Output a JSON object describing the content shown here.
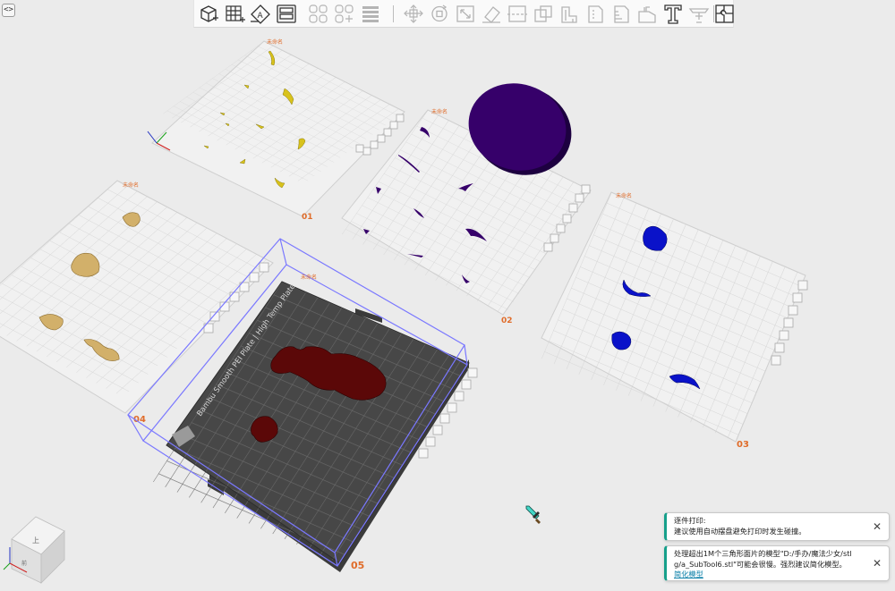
{
  "toolbar": {
    "collapse_label": "<>",
    "buttons": [
      {
        "icon": "add-object-icon",
        "label": ""
      },
      {
        "icon": "add-plate-icon",
        "label": ""
      },
      {
        "icon": "auto-orient-icon",
        "label": ""
      },
      {
        "icon": "arrange-icon",
        "label": ""
      },
      {
        "icon": "grid-layout-icon",
        "label": ""
      },
      {
        "icon": "grid-split-icon",
        "label": ""
      },
      {
        "icon": "list-layers-icon",
        "label": ""
      },
      {
        "icon": "move-icon",
        "label": ""
      },
      {
        "icon": "rotate-icon",
        "label": ""
      },
      {
        "icon": "scale-icon",
        "label": ""
      },
      {
        "icon": "lay-on-face-icon",
        "label": ""
      },
      {
        "icon": "cut-icon",
        "label": ""
      },
      {
        "icon": "boolean-icon",
        "label": ""
      },
      {
        "icon": "paint-support-icon",
        "label": ""
      },
      {
        "icon": "paint-seam-icon",
        "label": ""
      },
      {
        "icon": "measure-icon",
        "label": ""
      },
      {
        "icon": "color-paint-icon",
        "label": ""
      },
      {
        "icon": "text-emboss-icon",
        "label": "T"
      },
      {
        "icon": "assembly-icon",
        "label": ""
      },
      {
        "icon": "split-parts-icon",
        "label": ""
      }
    ]
  },
  "plates": [
    {
      "number": "01",
      "name": "未命名"
    },
    {
      "number": "02",
      "name": "未命名"
    },
    {
      "number": "03",
      "name": "未命名"
    },
    {
      "number": "04",
      "name": "未命名"
    },
    {
      "number": "05",
      "name": "未命名"
    }
  ],
  "plate_texture_text": "Bambu Smooth PEI Plate | High Temp Plate",
  "view_cube": {
    "top_label": "上",
    "front_label": "前"
  },
  "notifications": [
    {
      "title": "逐件打印:",
      "lines": [
        "建议使用自动摆盘避免打印时发生碰撞。"
      ],
      "link": ""
    },
    {
      "title": "",
      "lines": [
        "处理超出1M个三角形面片的模型\"D:/手办/魔法少女/stl",
        "g/a_SubTool6.stl\"可能会很慢。强烈建议简化模型。"
      ],
      "link": "简化模型"
    }
  ],
  "colors": {
    "background": "#ebebeb",
    "plate": "#f1f1f1",
    "plate_grid": "#d7d7d7",
    "active_plate": "#474747",
    "active_grid": "#6a6a6a",
    "selection_box": "#7a78ff",
    "plate_number": "#e06c2a",
    "yellow_parts": "#d8c21c",
    "tan_parts": "#d2b06a",
    "purple_parts": "#36006a",
    "blue_parts": "#0a12c9",
    "maroon_parts": "#5b0808",
    "toast_accent": "#16a08b"
  }
}
